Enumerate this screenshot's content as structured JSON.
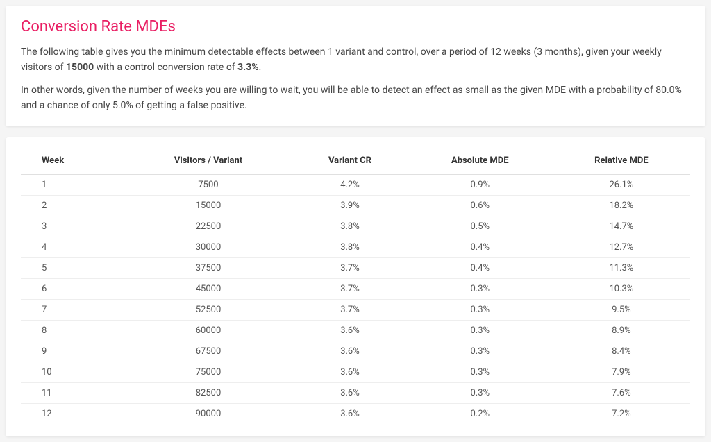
{
  "header": {
    "title": "Conversion Rate MDEs",
    "desc1_pre": "The following table gives you the minimum detectable effects between 1 variant and control, over a period of 12 weeks (3 months), given your weekly visitors of ",
    "visitors": "15000",
    "desc1_mid": " with a control conversion rate of ",
    "control_cr": "3.3%",
    "desc1_end": ".",
    "desc2": "In other words, given the number of weeks you are willing to wait, you will be able to detect an effect as small as the given MDE with a probability of 80.0% and a chance of only 5.0% of getting a false positive."
  },
  "table": {
    "headers": {
      "week": "Week",
      "visitors": "Visitors / Variant",
      "variant_cr": "Variant CR",
      "abs_mde": "Absolute MDE",
      "rel_mde": "Relative MDE"
    },
    "rows": [
      {
        "week": "1",
        "visitors": "7500",
        "variant_cr": "4.2%",
        "abs_mde": "0.9%",
        "rel_mde": "26.1%"
      },
      {
        "week": "2",
        "visitors": "15000",
        "variant_cr": "3.9%",
        "abs_mde": "0.6%",
        "rel_mde": "18.2%"
      },
      {
        "week": "3",
        "visitors": "22500",
        "variant_cr": "3.8%",
        "abs_mde": "0.5%",
        "rel_mde": "14.7%"
      },
      {
        "week": "4",
        "visitors": "30000",
        "variant_cr": "3.8%",
        "abs_mde": "0.4%",
        "rel_mde": "12.7%"
      },
      {
        "week": "5",
        "visitors": "37500",
        "variant_cr": "3.7%",
        "abs_mde": "0.4%",
        "rel_mde": "11.3%"
      },
      {
        "week": "6",
        "visitors": "45000",
        "variant_cr": "3.7%",
        "abs_mde": "0.3%",
        "rel_mde": "10.3%"
      },
      {
        "week": "7",
        "visitors": "52500",
        "variant_cr": "3.7%",
        "abs_mde": "0.3%",
        "rel_mde": "9.5%"
      },
      {
        "week": "8",
        "visitors": "60000",
        "variant_cr": "3.6%",
        "abs_mde": "0.3%",
        "rel_mde": "8.9%"
      },
      {
        "week": "9",
        "visitors": "67500",
        "variant_cr": "3.6%",
        "abs_mde": "0.3%",
        "rel_mde": "8.4%"
      },
      {
        "week": "10",
        "visitors": "75000",
        "variant_cr": "3.6%",
        "abs_mde": "0.3%",
        "rel_mde": "7.9%"
      },
      {
        "week": "11",
        "visitors": "82500",
        "variant_cr": "3.6%",
        "abs_mde": "0.3%",
        "rel_mde": "7.6%"
      },
      {
        "week": "12",
        "visitors": "90000",
        "variant_cr": "3.6%",
        "abs_mde": "0.2%",
        "rel_mde": "7.2%"
      }
    ]
  }
}
